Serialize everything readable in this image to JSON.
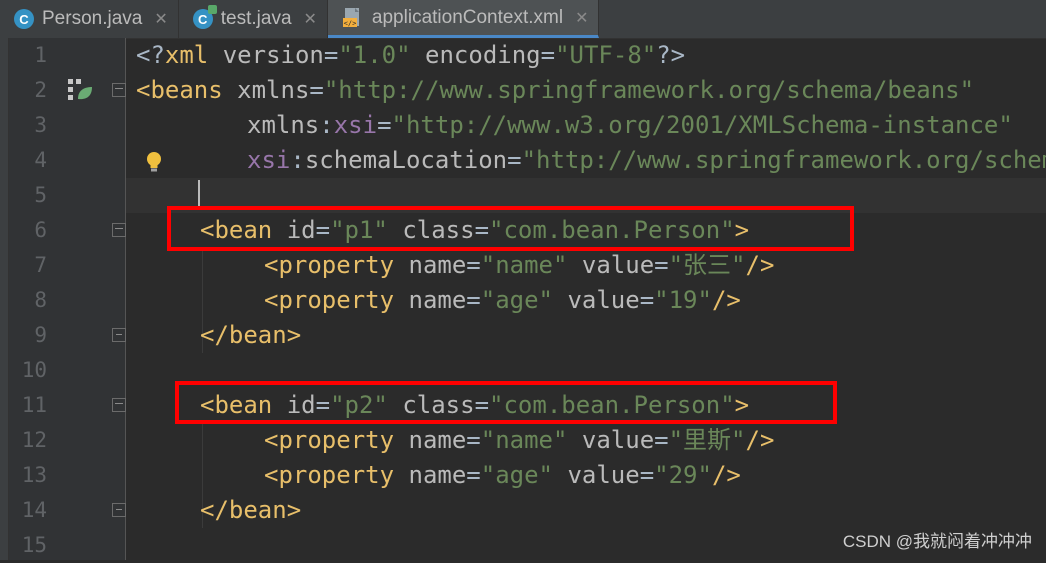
{
  "tabs": [
    {
      "label": "Person.java",
      "icon": "java-class-icon",
      "active": false
    },
    {
      "label": "test.java",
      "icon": "java-runnable-class-icon",
      "active": false
    },
    {
      "label": "applicationContext.xml",
      "icon": "xml-file-icon",
      "active": true
    }
  ],
  "colors": {
    "tag": "#e8bf6a",
    "attr": "#bababa",
    "namespace": "#9876aa",
    "string": "#6a8759",
    "text": "#a9b7c6",
    "highlight_box": "#ff0000"
  },
  "lines": [
    {
      "n": "1"
    },
    {
      "n": "2"
    },
    {
      "n": "3"
    },
    {
      "n": "4"
    },
    {
      "n": "5"
    },
    {
      "n": "6"
    },
    {
      "n": "7"
    },
    {
      "n": "8"
    },
    {
      "n": "9"
    },
    {
      "n": "10"
    },
    {
      "n": "11"
    },
    {
      "n": "12"
    },
    {
      "n": "13"
    },
    {
      "n": "14"
    },
    {
      "n": "15"
    }
  ],
  "code": {
    "l1": {
      "open": "<?",
      "name": "xml",
      "a1": "version",
      "v1": "\"1.0\"",
      "a2": "encoding",
      "v2": "\"UTF-8\"",
      "close": "?>"
    },
    "l2": {
      "open": "<",
      "name": "beans",
      "attr": "xmlns",
      "value": "\"http://www.springframework.org/schema/beans\""
    },
    "l3": {
      "attr": "xmlns",
      "ns": "xsi",
      "value": "\"http://www.w3.org/2001/XMLSchema-instance\""
    },
    "l4": {
      "ns": "xsi",
      "attr": "schemaLocation",
      "value": "\"http://www.springframework.org/schema/beans"
    },
    "l6": {
      "open": "<",
      "name": "bean",
      "a1": "id",
      "v1": "\"p1\"",
      "a2": "class",
      "v2": "\"com.bean.Person\"",
      "close": ">"
    },
    "l7": {
      "open": "<",
      "name": "property",
      "a1": "name",
      "v1": "\"name\"",
      "a2": "value",
      "v2": "\"张三\"",
      "close": "/>"
    },
    "l8": {
      "open": "<",
      "name": "property",
      "a1": "name",
      "v1": "\"age\"",
      "a2": "value",
      "v2": "\"19\"",
      "close": "/>"
    },
    "l9": {
      "open": "</",
      "name": "bean",
      "close": ">"
    },
    "l11": {
      "open": "<",
      "name": "bean",
      "a1": "id",
      "v1": "\"p2\"",
      "a2": "class",
      "v2": "\"com.bean.Person\"",
      "close": ">"
    },
    "l12": {
      "open": "<",
      "name": "property",
      "a1": "name",
      "v1": "\"name\"",
      "a2": "value",
      "v2": "\"里斯\"",
      "close": "/>"
    },
    "l13": {
      "open": "<",
      "name": "property",
      "a1": "name",
      "v1": "\"age\"",
      "a2": "value",
      "v2": "\"29\"",
      "close": "/>"
    },
    "l14": {
      "open": "</",
      "name": "bean",
      "close": ">"
    }
  },
  "watermark": "CSDN @我就闷着冲冲冲"
}
